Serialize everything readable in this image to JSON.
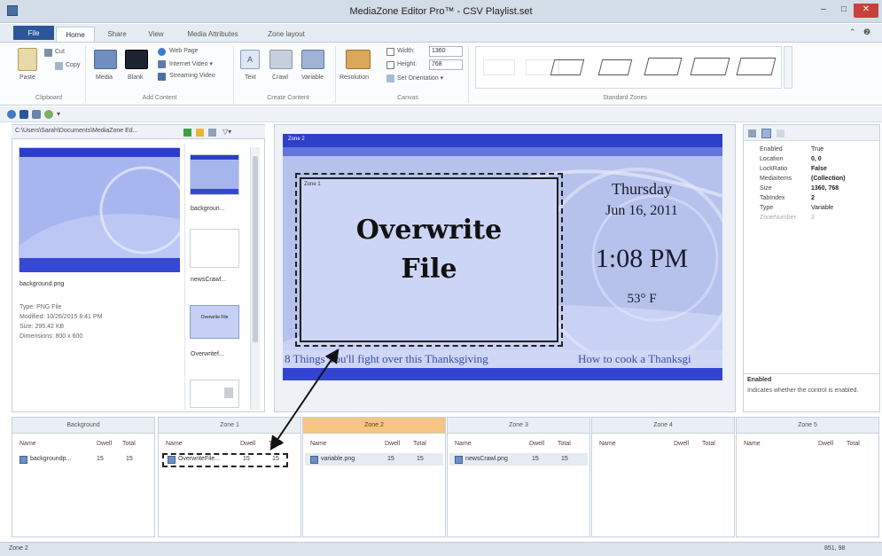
{
  "window": {
    "title": "MediaZone Editor Pro™ - CSV Playlist.set",
    "controls": [
      "–",
      "□",
      "✕"
    ]
  },
  "ribbon": {
    "tabs": [
      "File",
      "Home",
      "Share",
      "View",
      "Media Attributes",
      "Zone layout"
    ],
    "clipboard": {
      "paste": "Paste",
      "cut": "Cut",
      "copy": "Copy",
      "group": "Clipboard"
    },
    "add_content": {
      "media": "Media",
      "blank": "Blank",
      "web_page": "Web Page",
      "internet_video": "Internet Video ▾",
      "streaming_video": "Streaming Video",
      "group": "Add Content"
    },
    "create_content": {
      "text": "Text",
      "crawl": "Crawl",
      "variable": "Variable",
      "group": "Create Content"
    },
    "canvas": {
      "resolution": "Resolution",
      "width_label": "Width:",
      "width_value": "1360",
      "height_label": "Height:",
      "height_value": "768",
      "orientation": "Set Orientation ▾",
      "group": "Canvas"
    },
    "layout_group": "Standard Zones"
  },
  "left": {
    "path": "C:\\Users\\Sarah\\Documents\\MediaZone Ed...",
    "selected_file": "background.png",
    "details": {
      "type": "Type: PNG File",
      "modified": "Modified: 10/26/2015 8:41 PM",
      "size": "Size: 295.42 KB",
      "dimensions": "Dimensions: 800 x 600"
    },
    "thumbs": [
      "backgroun...",
      "newsCrawl...",
      "Overwrite File",
      "Overwritef..."
    ]
  },
  "canvas": {
    "zone1_label": "Zone 1",
    "zone2_label": "Zone 2",
    "main_text_line1": "Overwrite",
    "main_text_line2": "File",
    "day": "Thursday",
    "date": "Jun 16, 2011",
    "time": "1:08 PM",
    "temp": "53° F",
    "crawl_left": "8 Things You'll fight over this Thanksgiving",
    "crawl_right": "How to cook a Thanksgi"
  },
  "properties": {
    "rows": [
      {
        "name": "Enabled",
        "value": "True"
      },
      {
        "name": "Location",
        "value": "0, 0"
      },
      {
        "name": "LockRatio",
        "value": "False"
      },
      {
        "name": "MediaItems",
        "value": "(Collection)"
      },
      {
        "name": "Size",
        "value": "1360, 768"
      },
      {
        "name": "TabIndex",
        "value": "2"
      },
      {
        "name": "Type",
        "value": "Variable"
      },
      {
        "name": "ZoneNumber",
        "value": "2"
      }
    ],
    "desc_title": "Enabled",
    "desc_text": "Indicates whether the control is enabled."
  },
  "zones": [
    {
      "label": "Background",
      "file": "backgroundp...",
      "dwell": "15",
      "total": "15"
    },
    {
      "label": "Zone 1",
      "file": "OverwriteFile...",
      "dwell": "15",
      "total": "15"
    },
    {
      "label": "Zone 2",
      "file": "variable.png",
      "dwell": "15",
      "total": "15"
    },
    {
      "label": "Zone 3",
      "file": "newsCrawl.png",
      "dwell": "15",
      "total": "15"
    },
    {
      "label": "Zone 4",
      "file": "",
      "dwell": "",
      "total": ""
    },
    {
      "label": "Zone 5",
      "file": "",
      "dwell": "",
      "total": ""
    }
  ],
  "zone_columns": {
    "name": "Name",
    "dwell": "Dwell",
    "total": "Total"
  },
  "status": {
    "left": "Zone 2",
    "right": "851, 98"
  },
  "colors": {
    "accent": "#2b579a",
    "active_zone": "#f6c584",
    "canvas_bg": "#b6c1ec",
    "canvas_band": "#2e3fc8"
  }
}
